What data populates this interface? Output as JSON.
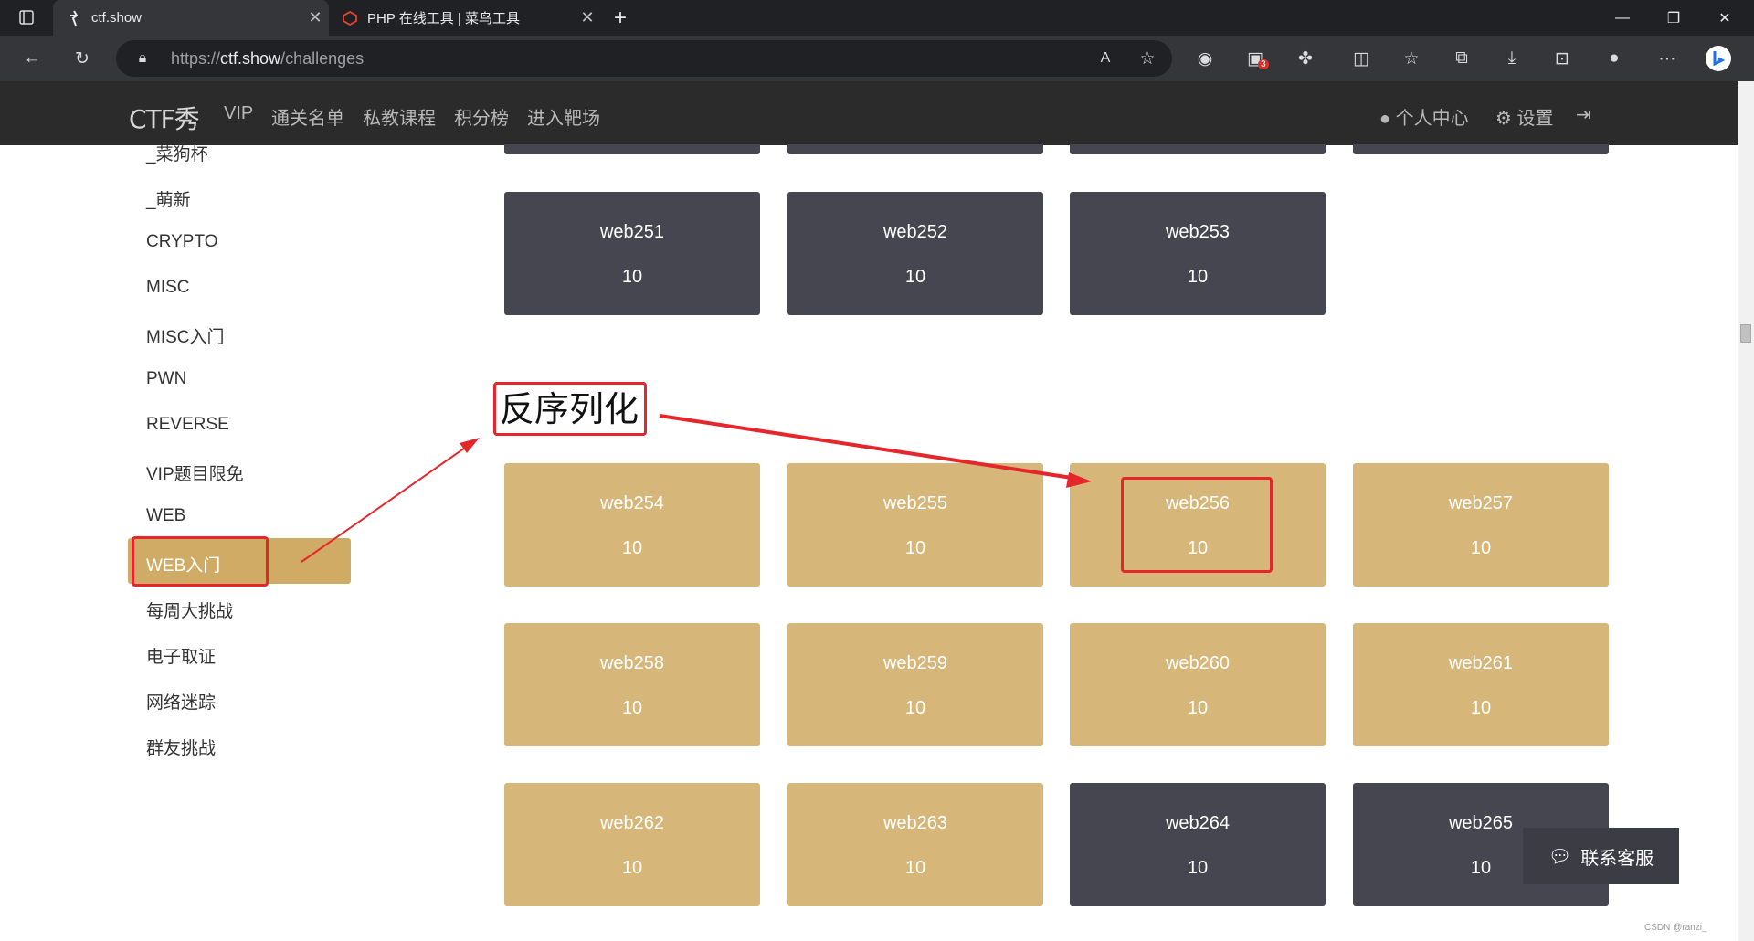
{
  "browser": {
    "tabs": [
      {
        "title": "ctf.show",
        "favicon": "ctfshow-icon",
        "active": true
      },
      {
        "title": "PHP 在线工具 | 菜鸟工具",
        "favicon": "runoob-icon",
        "active": false
      }
    ],
    "url_prefix": "https://",
    "url_host": "ctf.show",
    "url_path": "/challenges",
    "extension_badge": "3"
  },
  "site": {
    "logo": "CTF秀",
    "nav": [
      "VIP",
      "通关名单",
      "私教课程",
      "积分榜",
      "进入靶场"
    ],
    "user_center": "个人中心",
    "settings": "设置"
  },
  "sidebar": {
    "items": [
      "_菜狗杯",
      "_萌新",
      "CRYPTO",
      "MISC",
      "MISC入门",
      "PWN",
      "REVERSE",
      "VIP题目限免",
      "WEB",
      "WEB入门",
      "每周大挑战",
      "电子取证",
      "网络迷踪",
      "群友挑战"
    ],
    "active": "WEB入门"
  },
  "challenges": {
    "section_1": [
      {
        "name": "web251",
        "points": "10",
        "solved": false
      },
      {
        "name": "web252",
        "points": "10",
        "solved": false
      },
      {
        "name": "web253",
        "points": "10",
        "solved": false
      }
    ],
    "section_2": [
      {
        "name": "web254",
        "points": "10",
        "solved": true
      },
      {
        "name": "web255",
        "points": "10",
        "solved": true
      },
      {
        "name": "web256",
        "points": "10",
        "solved": true
      },
      {
        "name": "web257",
        "points": "10",
        "solved": true
      },
      {
        "name": "web258",
        "points": "10",
        "solved": true
      },
      {
        "name": "web259",
        "points": "10",
        "solved": true
      },
      {
        "name": "web260",
        "points": "10",
        "solved": true
      },
      {
        "name": "web261",
        "points": "10",
        "solved": true
      },
      {
        "name": "web262",
        "points": "10",
        "solved": true
      },
      {
        "name": "web263",
        "points": "10",
        "solved": true
      },
      {
        "name": "web264",
        "points": "10",
        "solved": false
      },
      {
        "name": "web265",
        "points": "10",
        "solved": false
      }
    ]
  },
  "annotation": {
    "label": "反序列化",
    "color": "#e5262a"
  },
  "support": {
    "label": "联系客服"
  },
  "watermark": "CSDN @ranzi_",
  "colors": {
    "dark_card": "#464650",
    "gold_card": "#d7b679",
    "nav_bg": "#2b2b2b",
    "active_item": "#d0ab65"
  }
}
